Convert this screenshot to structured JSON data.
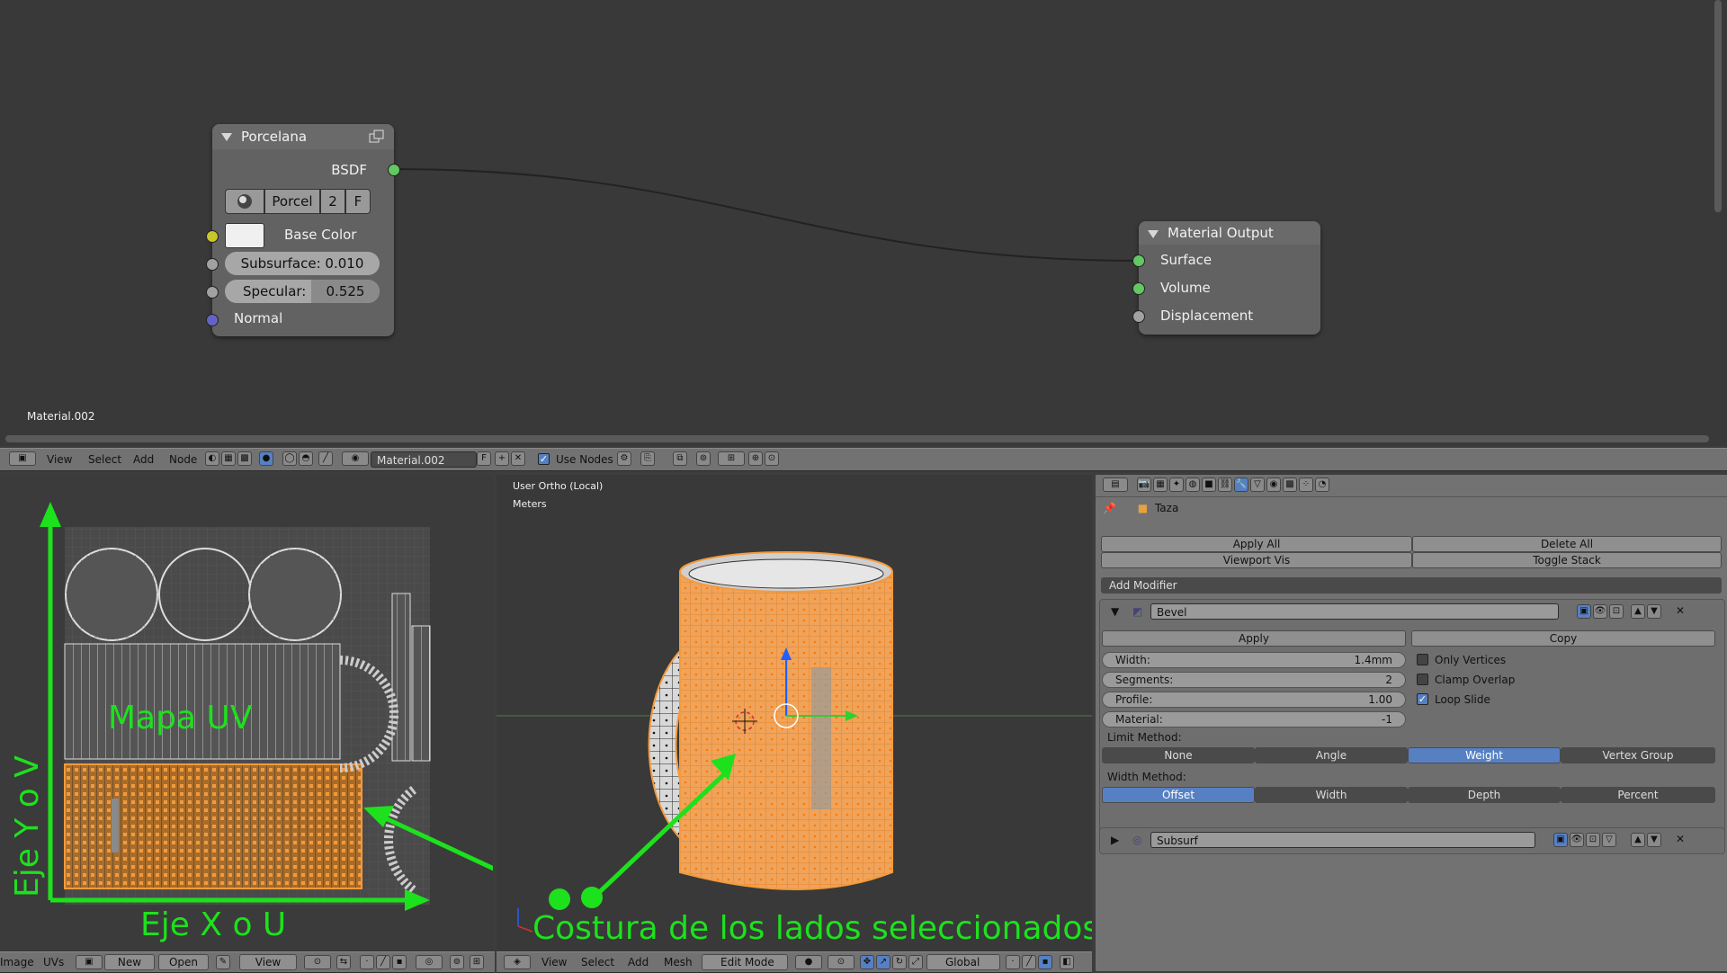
{
  "node_editor": {
    "node_porcelana": {
      "title": "Porcelana",
      "output_label": "BSDF",
      "material_selector": {
        "name": "Porcel",
        "users": "2",
        "fake": "F"
      },
      "inputs": {
        "base_color": "Base Color",
        "subsurface": "Subsurface: 0.010",
        "specular_label": "Specular:",
        "specular_value": "0.525",
        "normal": "Normal"
      }
    },
    "node_material_output": {
      "title": "Material Output",
      "inputs": {
        "surface": "Surface",
        "volume": "Volume",
        "displacement": "Displacement"
      }
    },
    "material_name_label": "Material.002",
    "header": {
      "menus": [
        "View",
        "Select",
        "Add",
        "Node"
      ],
      "material_field": "Material.002",
      "fake_user": "F",
      "use_nodes_label": "Use Nodes"
    }
  },
  "uv_editor": {
    "overlay": {
      "mapa_uv": "Mapa UV",
      "eje_y": "Eje Y o V",
      "eje_x": "Eje X o U"
    },
    "header": {
      "menus": [
        "Image",
        "UVs"
      ],
      "new_label": "New",
      "open_label": "Open",
      "view_label": "View"
    }
  },
  "viewport": {
    "info_view": "User Ortho (Local)",
    "info_units": "Meters",
    "overlay_text": "Costura de los lados seleccionados",
    "header": {
      "menus": [
        "View",
        "Select",
        "Add",
        "Mesh"
      ],
      "mode": "Edit Mode",
      "orientation": "Global"
    }
  },
  "properties": {
    "object_name": "Taza",
    "buttons": {
      "apply_all": "Apply All",
      "delete_all": "Delete All",
      "viewport_vis": "Viewport Vis",
      "toggle_stack": "Toggle Stack",
      "add_modifier": "Add Modifier"
    },
    "bevel": {
      "name": "Bevel",
      "apply": "Apply",
      "copy": "Copy",
      "fields": {
        "width_label": "Width:",
        "width_value": "1.4mm",
        "segments_label": "Segments:",
        "segments_value": "2",
        "profile_label": "Profile:",
        "profile_value": "1.00",
        "material_label": "Material:",
        "material_value": "-1"
      },
      "checkboxes": {
        "only_vertices": "Only Vertices",
        "clamp_overlap": "Clamp Overlap",
        "loop_slide": "Loop Slide"
      },
      "limit_method_label": "Limit Method:",
      "limit_methods": [
        "None",
        "Angle",
        "Weight",
        "Vertex Group"
      ],
      "width_method_label": "Width Method:",
      "width_methods": [
        "Offset",
        "Width",
        "Depth",
        "Percent"
      ]
    },
    "subsurf": {
      "name": "Subsurf"
    }
  },
  "colors": {
    "accent": "#5680c2",
    "annotation_green": "#1de11d",
    "selection_orange": "#f49a3c"
  }
}
